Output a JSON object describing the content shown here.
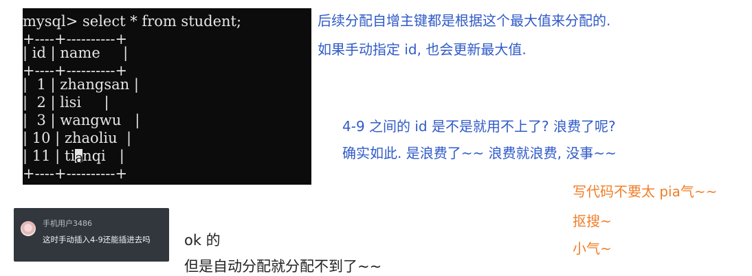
{
  "terminal": {
    "prompt_line": "mysql> select * from student;",
    "border": "+----+----------+",
    "header": {
      "col_id": "id",
      "col_name": "name"
    },
    "rows": [
      {
        "id": "1",
        "name": "zhangsan"
      },
      {
        "id": "2",
        "name": "lisi"
      },
      {
        "id": "3",
        "name": "wangwu"
      },
      {
        "id": "10",
        "name": "zhaoliu"
      },
      {
        "id": "11",
        "name_before_cursor": "ti",
        "name_cursor": "a",
        "name_after_cursor": "nqi"
      }
    ]
  },
  "notes": {
    "top_right_line1": "后续分配自增主键都是根据这个最大值来分配的.",
    "top_right_line2": "如果手动指定 id, 也会更新最大值.",
    "mid_right_line1": "4-9 之间的 id 是不是就用不上了? 浪费了呢?",
    "mid_right_line2": "确实如此. 是浪费了~~ 浪费就浪费, 没事~~",
    "orange_line1": "写代码不要太 pia气~~",
    "orange_line2": "抠搜~",
    "orange_line3": "小气~",
    "bottom_line1": "ok 的",
    "bottom_line2": "但是自动分配就分配不到了~~"
  },
  "comment": {
    "user": "手机用户3486",
    "text": "这时手动插入4-9还能插进去吗"
  },
  "colors": {
    "terminal_bg": "#0c0c0c",
    "blue_text": "#2f5ac7",
    "orange_text": "#f07e27",
    "card_bg": "#31373d"
  }
}
